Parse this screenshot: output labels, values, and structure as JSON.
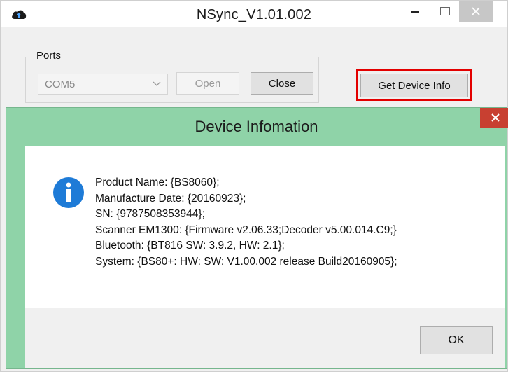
{
  "app": {
    "title": "NSync_V1.01.002",
    "icons": {
      "app": "cloud-upload-icon",
      "minimize": "minimize-icon",
      "maximize": "maximize-icon",
      "close": "close-icon"
    }
  },
  "ports": {
    "group_label": "Ports",
    "selected_port": "COM5",
    "open_label": "Open",
    "close_label": "Close"
  },
  "toolbar": {
    "get_device_info_label": "Get Device Info"
  },
  "dialog": {
    "title": "Device Infomation",
    "icon": "info-icon",
    "lines": [
      "Product Name: {BS8060};",
      "Manufacture Date: {20160923};",
      "SN: {9787508353944};",
      "Scanner EM1300: {Firmware v2.06.33;Decoder v5.00.014.C9;}",
      "Bluetooth: {BT816 SW: 3.9.2, HW: 2.1};",
      "System: {BS80+: HW:  SW: V1.00.002 release Build20160905};"
    ],
    "ok_label": "OK"
  },
  "colors": {
    "dialog_frame": "#8fd3a8",
    "dialog_close": "#c84031",
    "highlight": "#e30000",
    "info_icon": "#1e7bd7"
  }
}
